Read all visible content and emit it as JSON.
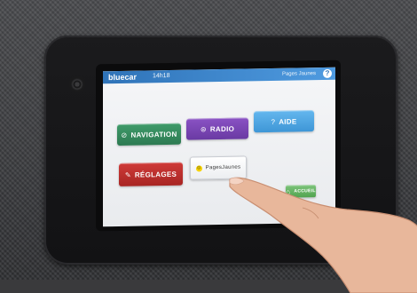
{
  "header": {
    "logo": "bluecar",
    "time": "14h18",
    "brand": "Pages Jaunes",
    "help_glyph": "?"
  },
  "tiles": {
    "navigation": {
      "label": "NAVIGATION",
      "icon": "compass-icon",
      "glyph": "⊘"
    },
    "radio": {
      "label": "RADIO",
      "icon": "radio-waves-icon",
      "glyph": "⊜"
    },
    "aide": {
      "label": "AIDE",
      "icon": "help-circle-icon",
      "glyph": "?"
    },
    "reglages": {
      "label": "RÉGLAGES",
      "icon": "wrench-icon",
      "glyph": "✎"
    },
    "pagesjaunes": {
      "label": "PagesJaunes",
      "icon": "pagesjaunes-logo-icon",
      "glyph": "☺"
    },
    "accueil": {
      "label": "ACCUEIL",
      "icon": "home-icon",
      "glyph": "⌂"
    }
  },
  "colors": {
    "topbar": "#2f73b8",
    "navigation": "#3f9b6a",
    "radio": "#8a52c4",
    "aide": "#64b7ee",
    "reglages": "#cf3a38",
    "accueil": "#52a34f"
  }
}
